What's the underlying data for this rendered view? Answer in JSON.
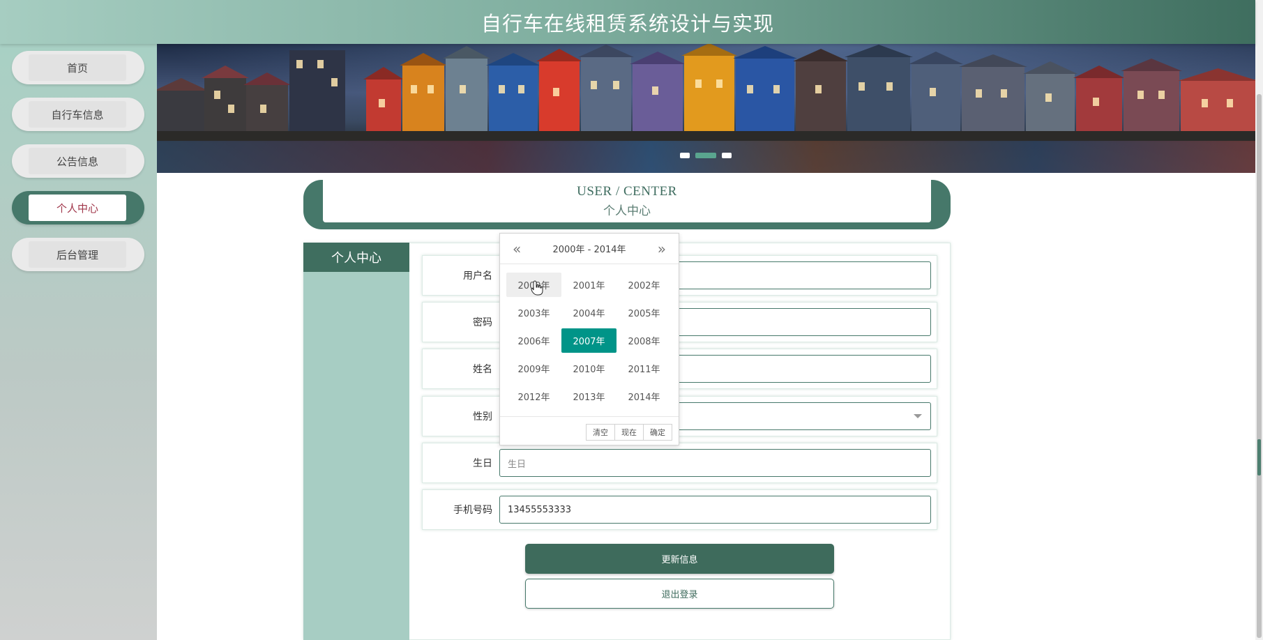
{
  "header": {
    "title": "自行车在线租赁系统设计与实现"
  },
  "sidebar": {
    "items": [
      {
        "label": "首页",
        "active": false
      },
      {
        "label": "自行车信息",
        "active": false
      },
      {
        "label": "公告信息",
        "active": false
      },
      {
        "label": "个人中心",
        "active": true
      },
      {
        "label": "后台管理",
        "active": false
      }
    ]
  },
  "banner": {
    "slide_count": 3,
    "active_slide": 2
  },
  "user_center": {
    "title_en": "USER / CENTER",
    "title_cn": "个人中心",
    "side_title": "个人中心"
  },
  "form": {
    "username_label": "用户名",
    "username_value": "",
    "password_label": "密码",
    "password_value": "",
    "name_label": "姓名",
    "name_value": "",
    "gender_label": "性别",
    "gender_value": "",
    "birthday_label": "生日",
    "birthday_placeholder": "生日",
    "phone_label": "手机号码",
    "phone_value": "13455553333"
  },
  "buttons": {
    "update": "更新信息",
    "logout": "退出登录"
  },
  "year_picker": {
    "range": "2000年 - 2014年",
    "prev": "«",
    "next": "»",
    "years": [
      "2000年",
      "2001年",
      "2002年",
      "2003年",
      "2004年",
      "2005年",
      "2006年",
      "2007年",
      "2008年",
      "2009年",
      "2010年",
      "2011年",
      "2012年",
      "2013年",
      "2014年"
    ],
    "selected": "2007年",
    "hovered": "2000年",
    "clear": "清空",
    "now": "现在",
    "confirm": "确定"
  },
  "colors": {
    "primary": "#46786a",
    "dark": "#3f6e5f",
    "selected": "#009488",
    "active_text": "#a0364a"
  }
}
